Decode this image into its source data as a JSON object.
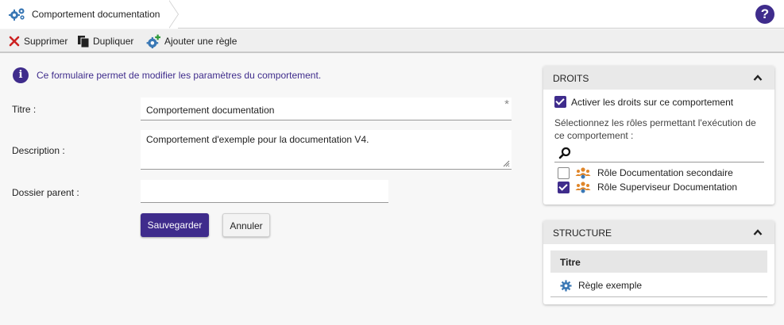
{
  "header": {
    "title": "Comportement documentation",
    "help_icon": "question-circle-icon",
    "help_label": "?"
  },
  "toolbar": {
    "delete_label": "Supprimer",
    "duplicate_label": "Dupliquer",
    "add_rule_label": "Ajouter une règle"
  },
  "info": {
    "icon_label": "i",
    "text": "Ce formulaire permet de modifier les paramètres du comportement."
  },
  "form": {
    "title_label": "Titre :",
    "title_value": "Comportement documentation",
    "required_mark": "*",
    "description_label": "Description :",
    "description_value": "Comportement d'exemple pour la documentation V4.",
    "parent_label": "Dossier parent :",
    "parent_value": "",
    "save_label": "Sauvegarder",
    "cancel_label": "Annuler"
  },
  "droits": {
    "title": "DROITS",
    "activate_label": "Activer les droits sur ce comportement",
    "activate_checked": true,
    "select_text": "Sélectionnez les rôles permettant l'exécution de ce comportement :",
    "roles": [
      {
        "label": "Rôle Documentation secondaire",
        "checked": false
      },
      {
        "label": "Rôle Superviseur Documentation",
        "checked": true
      }
    ]
  },
  "structure": {
    "title": "STRUCTURE",
    "column_header": "Titre",
    "rows": [
      {
        "label": "Règle exemple",
        "icon": "gear-icon"
      }
    ]
  },
  "colors": {
    "accent": "#3f2c8c",
    "delete_red": "#cc2222",
    "gear_blue": "#3a78b5",
    "group_orange": "#e0862a"
  }
}
